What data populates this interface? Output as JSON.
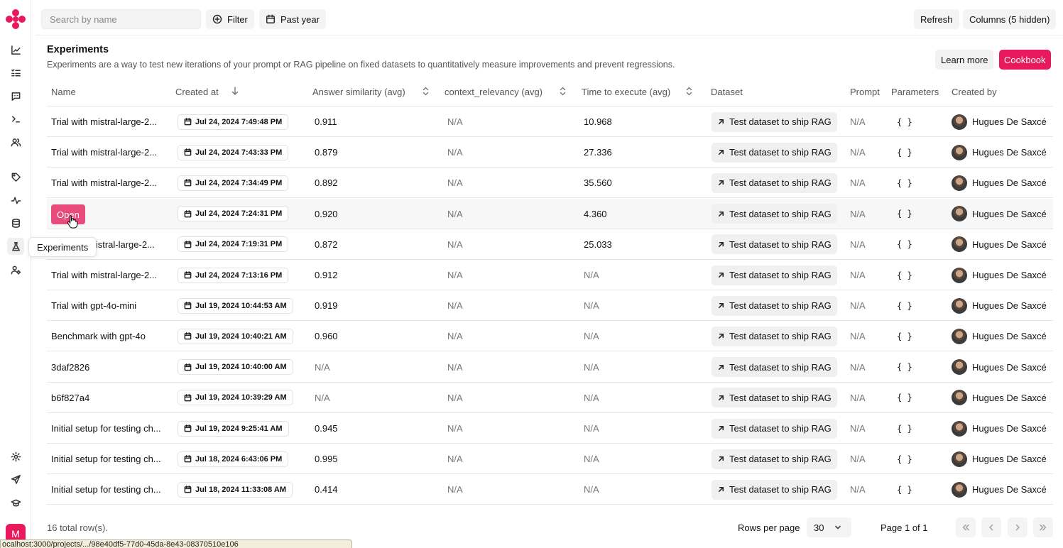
{
  "colors": {
    "brand": "#e8195c",
    "open_button": "#e84b7c"
  },
  "sidebar": {
    "icons": [
      "logo-icon",
      "chart-line-icon",
      "list-checks-icon",
      "message-square-icon",
      "terminal-icon",
      "users-icon",
      "tag-icon",
      "activity-icon",
      "database-icon",
      "flask-icon",
      "user-cog-icon",
      "gear-icon",
      "send-icon",
      "graduation-cap-icon"
    ],
    "active": "flask-icon",
    "tooltip": "Experiments",
    "user_initial": "M"
  },
  "toolbar": {
    "search_placeholder": "Search by name",
    "filter_label": "Filter",
    "date_range_label": "Past year",
    "refresh_label": "Refresh",
    "columns_label": "Columns (5 hidden)"
  },
  "header": {
    "title": "Experiments",
    "description": "Experiments are a way to test new iterations of your prompt or RAG pipeline on fixed datasets to quantitatively measure improvements and prevent regressions.",
    "learn_more": "Learn more",
    "cookbook": "Cookbook"
  },
  "table": {
    "columns": [
      "Name",
      "Created at",
      "Answer similarity (avg)",
      "context_relevancy (avg)",
      "Time to execute (avg)",
      "Dataset",
      "Prompt",
      "Parameters",
      "Created by"
    ],
    "rows": [
      {
        "name": "Trial with mistral-large-2...",
        "created": "Jul 24, 2024 7:49:48 PM",
        "sim": "0.911",
        "ctx": "N/A",
        "time": "10.968",
        "dataset": "Test dataset to ship RAG",
        "prompt": "N/A",
        "params": "{ }",
        "by": "Hugues De Saxcé"
      },
      {
        "name": "Trial with mistral-large-2...",
        "created": "Jul 24, 2024 7:43:33 PM",
        "sim": "0.879",
        "ctx": "N/A",
        "time": "27.336",
        "dataset": "Test dataset to ship RAG",
        "prompt": "N/A",
        "params": "{ }",
        "by": "Hugues De Saxcé"
      },
      {
        "name": "Trial with mistral-large-2...",
        "created": "Jul 24, 2024 7:34:49 PM",
        "sim": "0.892",
        "ctx": "N/A",
        "time": "35.560",
        "dataset": "Test dataset to ship RAG",
        "prompt": "N/A",
        "params": "{ }",
        "by": "Hugues De Saxcé"
      },
      {
        "name": "",
        "created": "Jul 24, 2024 7:24:31 PM",
        "sim": "0.920",
        "ctx": "N/A",
        "time": "4.360",
        "dataset": "Test dataset to ship RAG",
        "prompt": "N/A",
        "params": "{ }",
        "by": "Hugues De Saxcé"
      },
      {
        "name": "mistral-large-2...",
        "created": "Jul 24, 2024 7:19:31 PM",
        "sim": "0.872",
        "ctx": "N/A",
        "time": "25.033",
        "dataset": "Test dataset to ship RAG",
        "prompt": "N/A",
        "params": "{ }",
        "by": "Hugues De Saxcé"
      },
      {
        "name": "Trial with mistral-large-2...",
        "created": "Jul 24, 2024 7:13:16 PM",
        "sim": "0.912",
        "ctx": "N/A",
        "time": "N/A",
        "dataset": "Test dataset to ship RAG",
        "prompt": "N/A",
        "params": "{ }",
        "by": "Hugues De Saxcé"
      },
      {
        "name": "Trial with gpt-4o-mini",
        "created": "Jul 19, 2024 10:44:53 AM",
        "sim": "0.919",
        "ctx": "N/A",
        "time": "N/A",
        "dataset": "Test dataset to ship RAG",
        "prompt": "N/A",
        "params": "{ }",
        "by": "Hugues De Saxcé"
      },
      {
        "name": "Benchmark with gpt-4o",
        "created": "Jul 19, 2024 10:40:21 AM",
        "sim": "0.960",
        "ctx": "N/A",
        "time": "N/A",
        "dataset": "Test dataset to ship RAG",
        "prompt": "N/A",
        "params": "{ }",
        "by": "Hugues De Saxcé"
      },
      {
        "name": "3daf2826",
        "created": "Jul 19, 2024 10:40:00 AM",
        "sim": "N/A",
        "ctx": "N/A",
        "time": "N/A",
        "dataset": "Test dataset to ship RAG",
        "prompt": "N/A",
        "params": "{ }",
        "by": "Hugues De Saxcé"
      },
      {
        "name": "b6f827a4",
        "created": "Jul 19, 2024 10:39:29 AM",
        "sim": "N/A",
        "ctx": "N/A",
        "time": "N/A",
        "dataset": "Test dataset to ship RAG",
        "prompt": "N/A",
        "params": "{ }",
        "by": "Hugues De Saxcé"
      },
      {
        "name": "Initial setup for testing ch...",
        "created": "Jul 19, 2024 9:25:41 AM",
        "sim": "0.945",
        "ctx": "N/A",
        "time": "N/A",
        "dataset": "Test dataset to ship RAG",
        "prompt": "N/A",
        "params": "{ }",
        "by": "Hugues De Saxcé"
      },
      {
        "name": "Initial setup for testing ch...",
        "created": "Jul 18, 2024 6:43:06 PM",
        "sim": "0.995",
        "ctx": "N/A",
        "time": "N/A",
        "dataset": "Test dataset to ship RAG",
        "prompt": "N/A",
        "params": "{ }",
        "by": "Hugues De Saxcé"
      },
      {
        "name": "Initial setup for testing ch...",
        "created": "Jul 18, 2024 11:33:08 AM",
        "sim": "0.414",
        "ctx": "N/A",
        "time": "N/A",
        "dataset": "Test dataset to ship RAG",
        "prompt": "N/A",
        "params": "{ }",
        "by": "Hugues De Saxcé"
      }
    ],
    "open_label": "Open"
  },
  "footer": {
    "total_rows": "16 total row(s).",
    "rows_per_page_label": "Rows per page",
    "rows_per_page_value": "30",
    "page_info": "Page 1 of 1"
  },
  "statusbar": {
    "url": "ocalhost:3000/projects/.../98e40df5-77d0-45da-8e43-08370510e106"
  }
}
